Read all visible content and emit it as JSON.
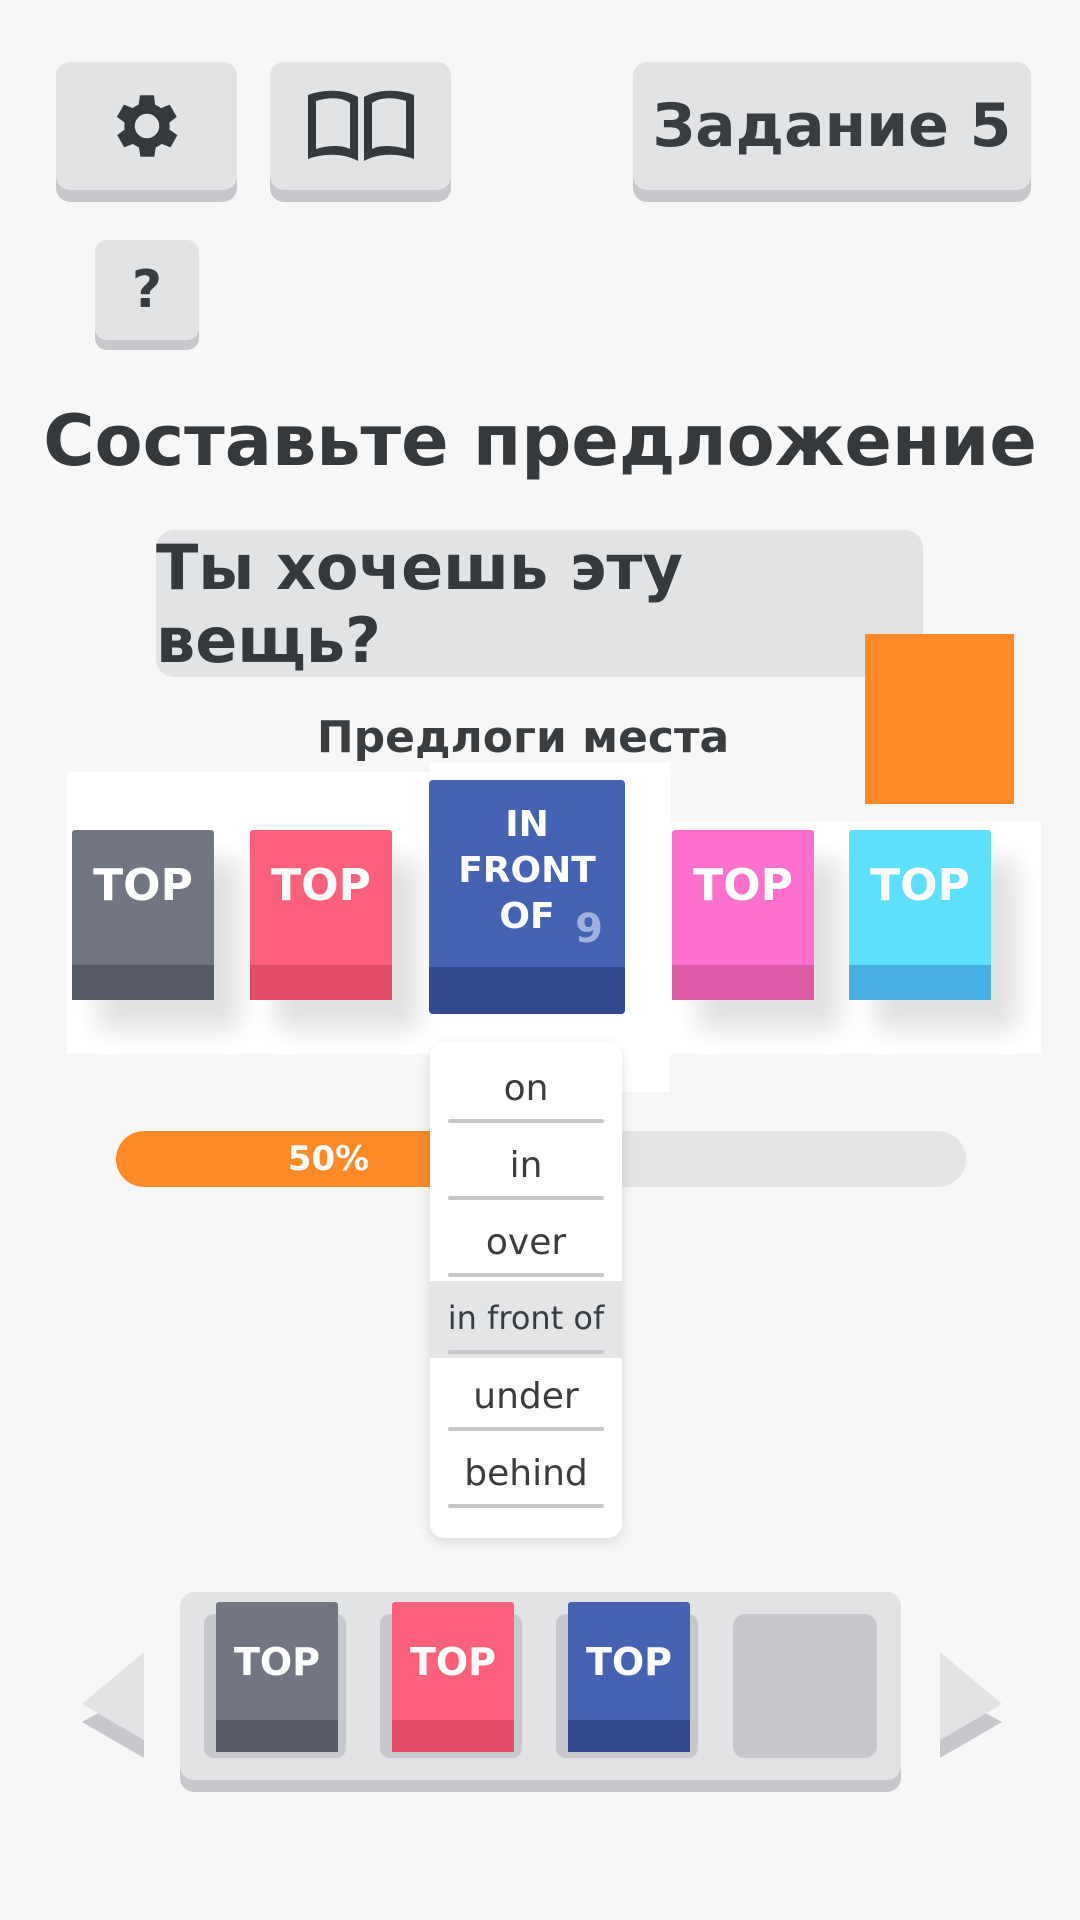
{
  "header": {
    "settings_icon": "gear-icon",
    "book_icon": "book-icon",
    "level_label": "Задание 5",
    "help_label": "?"
  },
  "task": {
    "title": "Составьте предложение",
    "sentence": "Ты хочешь эту вещь?",
    "topic": "Предлоги места"
  },
  "tiles": [
    {
      "label": "TOP"
    },
    {
      "label": "TOP"
    },
    {
      "label": "IN\nFRONT\nOF",
      "count": "9"
    },
    {
      "label": "TOP"
    },
    {
      "label": "TOP"
    }
  ],
  "progress": {
    "value": 0.5,
    "label": "50%"
  },
  "dropdown": {
    "options": [
      "on",
      "in",
      "over",
      "in front of",
      "under",
      "behind"
    ],
    "selected": "in front of"
  },
  "answer": {
    "tiles": [
      "TOP",
      "TOP",
      "TOP"
    ]
  },
  "colors": {
    "accent": "#fe8a27",
    "tile_gray": "#727682",
    "tile_red": "#fd607c",
    "tile_blue": "#4463b3",
    "tile_pink": "#fe70cd",
    "tile_cyan": "#5ddffe"
  }
}
